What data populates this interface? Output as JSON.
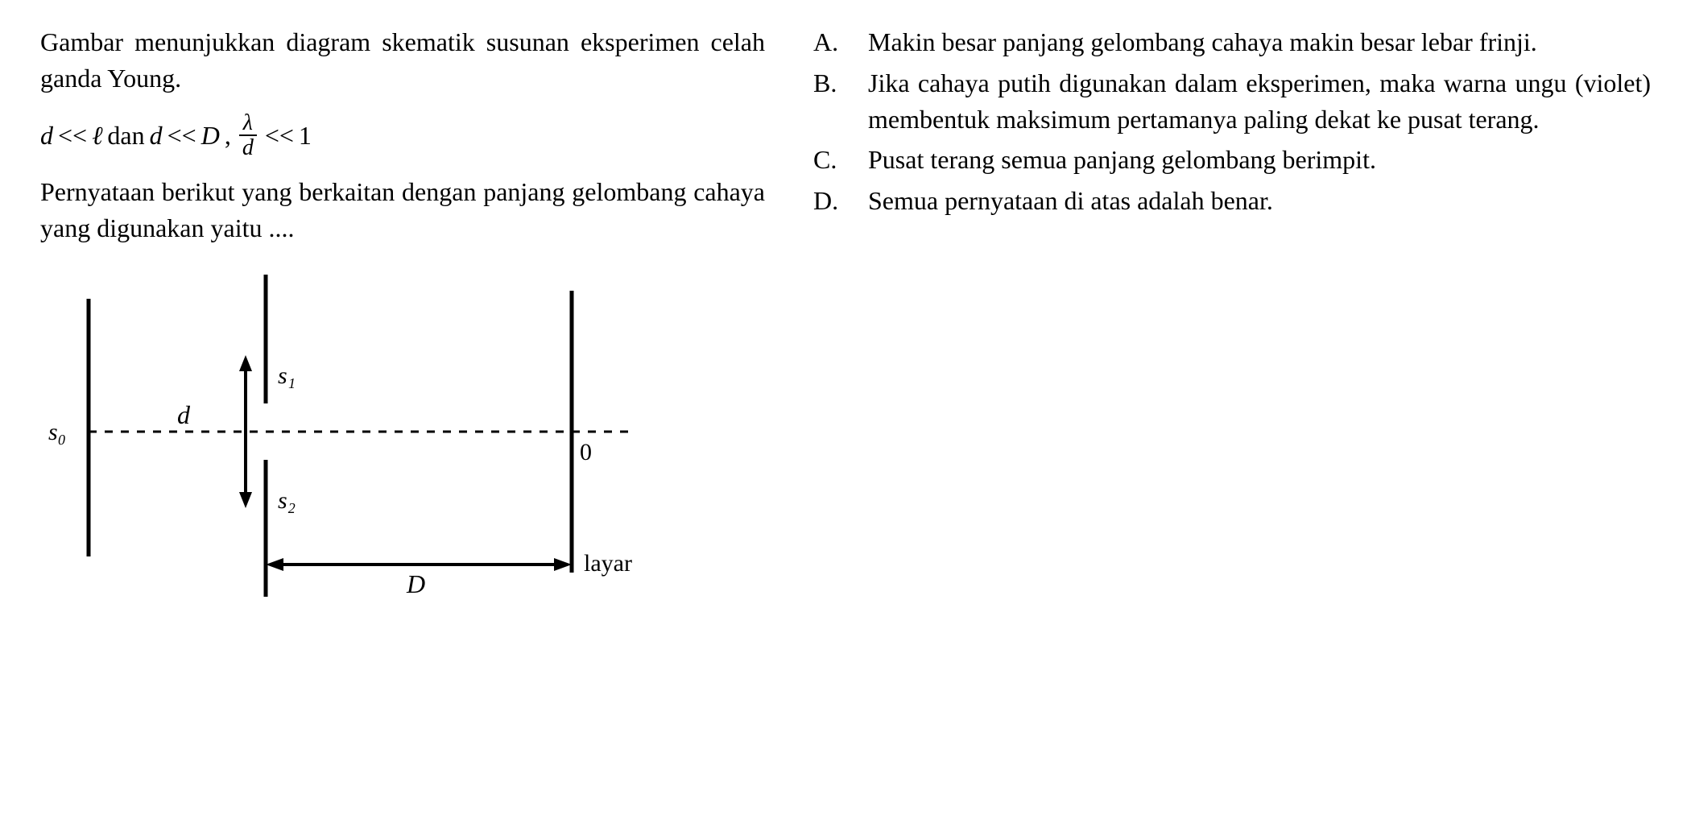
{
  "question": {
    "para1": "Gambar menunjukkan diagram skematik susunan eksperimen celah ganda Young.",
    "formula": {
      "d": "d",
      "ll1": "<<",
      "ell": "ℓ",
      "dan": "dan",
      "d2": "d",
      "ll2": "<<",
      "D": "D",
      "comma": ",",
      "frac_num": "λ",
      "frac_den": "d",
      "ll3": "<<",
      "one": "1"
    },
    "para2": "Pernyataan berikut yang berkaitan dengan panjang gelombang cahaya yang digunakan yaitu ...."
  },
  "options": [
    {
      "letter": "A.",
      "text": "Makin besar panjang gelombang cahaya makin besar lebar frinji."
    },
    {
      "letter": "B.",
      "text": "Jika cahaya putih digunakan dalam eksperimen, maka warna ungu (violet) membentuk maksimum pertamanya paling dekat ke pusat terang."
    },
    {
      "letter": "C.",
      "text": "Pusat terang semua panjang gelom­bang berimpit."
    },
    {
      "letter": "D.",
      "text": "Semua pernyataan di atas adalah benar."
    }
  ],
  "diagram": {
    "s0": "s₀",
    "s1": "s₁",
    "s2": "s₂",
    "d_label": "d",
    "D_label": "D",
    "zero": "0",
    "layar": "layar"
  }
}
